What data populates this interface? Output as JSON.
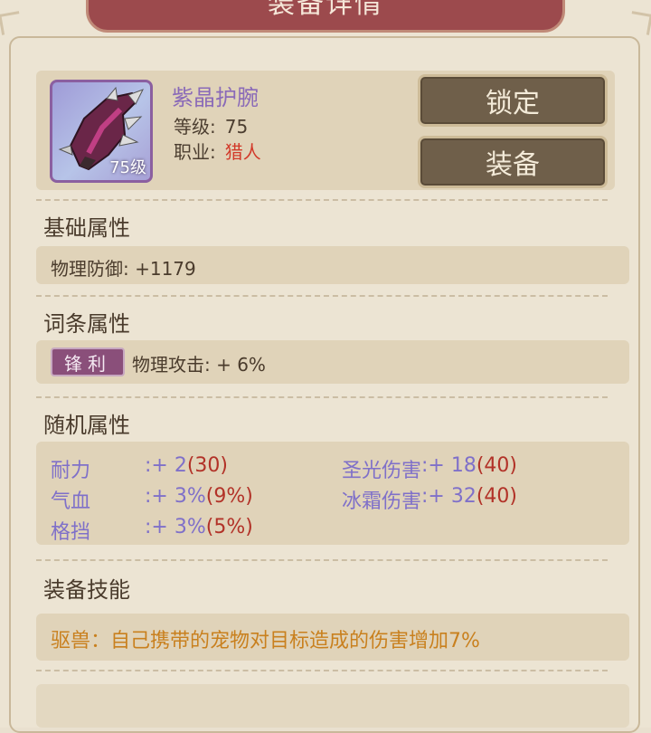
{
  "header": {
    "title": "装备详情"
  },
  "item": {
    "name": "紫晶护腕",
    "level_badge": "75级",
    "level_label": "等级:",
    "level_value": "75",
    "class_label": "职业:",
    "class_value": "猎人",
    "accent_color": "#8a6ab8",
    "icon": "crystal-bracer-icon"
  },
  "buttons": {
    "lock": "锁定",
    "equip": "装备"
  },
  "sections": {
    "basic": {
      "title": "基础属性",
      "text": "物理防御: +1179"
    },
    "affix": {
      "title": "词条属性",
      "tag": "锋利",
      "text": "物理攻击: + 6%"
    },
    "random": {
      "title": "随机属性",
      "left": [
        {
          "name": "耐力",
          "value": ":+ 2",
          "bracket": "(30)"
        },
        {
          "name": "气血",
          "value": ":+ 3%",
          "bracket": "(9%)"
        },
        {
          "name": "格挡",
          "value": ":+ 3%",
          "bracket": "(5%)"
        }
      ],
      "right": [
        {
          "name": "圣光伤害",
          "value": ":+ 18",
          "bracket": "(40)"
        },
        {
          "name": "冰霜伤害",
          "value": ":+ 32",
          "bracket": "(40)"
        }
      ]
    },
    "skill": {
      "title": "装备技能",
      "text": "驱兽：自己携带的宠物对目标造成的伤害增加7%"
    }
  }
}
